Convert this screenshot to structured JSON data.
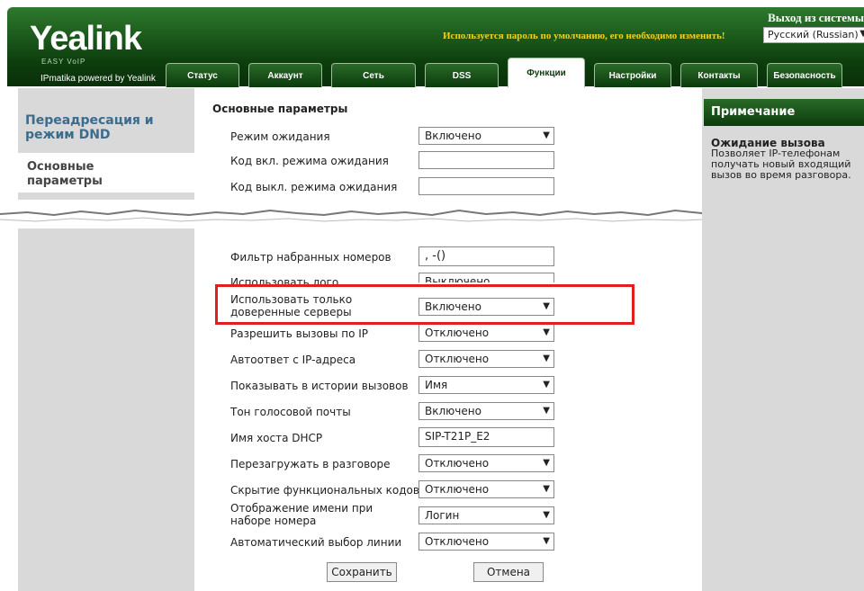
{
  "header": {
    "logo": "Yealink",
    "logo_sub": "EASY VoIP",
    "powered": "IPmatika powered by Yealink",
    "logout": "Выход из системы",
    "warning": "Используется пароль по умолчанию, его необходимо изменить!",
    "language": "Русский (Russian)"
  },
  "tabs": [
    {
      "label": "Статус"
    },
    {
      "label": "Аккаунт"
    },
    {
      "label": "Сеть"
    },
    {
      "label": "DSS"
    },
    {
      "label": "Функции"
    },
    {
      "label": "Настройки"
    },
    {
      "label": "Контакты"
    },
    {
      "label": "Безопасность"
    }
  ],
  "sidebar": {
    "items": [
      {
        "label": "Переадресация и режим DND"
      },
      {
        "label": "Основные параметры"
      }
    ]
  },
  "main": {
    "section_title": "Основные параметры",
    "rows_top": [
      {
        "label": "Режим ожидания",
        "value": "Включено"
      },
      {
        "label": "Код вкл. режима ожидания",
        "value": ""
      },
      {
        "label": "Код выкл. режима ожидания",
        "value": ""
      }
    ],
    "rows": [
      {
        "label": "Фильтр набранных номеров",
        "value": ", -()"
      },
      {
        "label": "Использовать лого",
        "value": "Выключено"
      },
      {
        "label": "Использовать только доверенные серверы",
        "value": "Включено"
      },
      {
        "label": "Разрешить вызовы по IP",
        "value": "Отключено"
      },
      {
        "label": "Автоответ с IP-адреса",
        "value": "Отключено"
      },
      {
        "label": "Показывать в истории вызовов",
        "value": "Имя"
      },
      {
        "label": "Тон голосовой почты",
        "value": "Включено"
      },
      {
        "label": "Имя хоста DHCP",
        "value": "SIP-T21P_E2"
      },
      {
        "label": "Перезагружать в разговоре",
        "value": "Отключено"
      },
      {
        "label": "Скрытие функциональных кодов",
        "value": "Отключено"
      },
      {
        "label": "Отображение имени при наборе номера",
        "value": "Логин"
      },
      {
        "label": "Автоматический выбор линии",
        "value": "Отключено"
      }
    ],
    "save_label": "Сохранить",
    "cancel_label": "Отмена"
  },
  "note": {
    "header": "Примечание",
    "title": "Ожидание вызова",
    "text": "Позволяет IP-телефонам получать новый входящий вызов во время разговора."
  },
  "colors": {
    "header_green": "#0d3d0d",
    "highlight_red": "#e02020",
    "nav_blue": "#3a6c8e"
  }
}
